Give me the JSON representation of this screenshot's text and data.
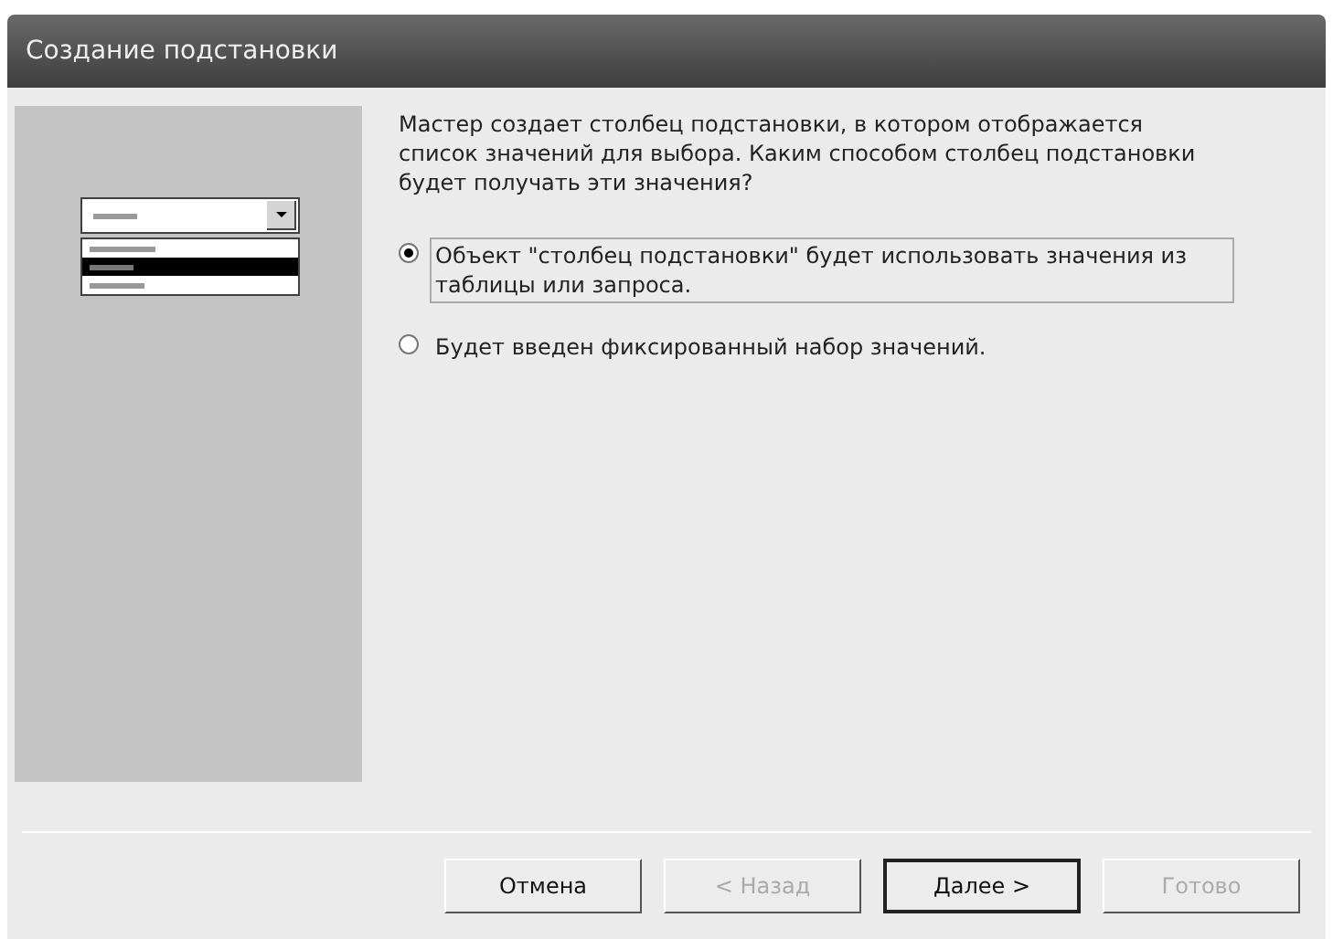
{
  "window": {
    "title": "Создание подстановки"
  },
  "description": "Мастер создает столбец подстановки, в котором отображается список значений для выбора.  Каким способом столбец подстановки будет получать эти значения?",
  "options": [
    {
      "label": "Объект \"столбец подстановки\" будет использовать значения из таблицы или запроса.",
      "selected": true
    },
    {
      "label": "Будет введен фиксированный набор значений.",
      "selected": false
    }
  ],
  "buttons": [
    {
      "label": "Отмена",
      "disabled": false,
      "default": false
    },
    {
      "label": "< Назад",
      "disabled": true,
      "default": false
    },
    {
      "label": "Далее >",
      "disabled": false,
      "default": true
    },
    {
      "label": "Готово",
      "disabled": true,
      "default": false
    }
  ]
}
